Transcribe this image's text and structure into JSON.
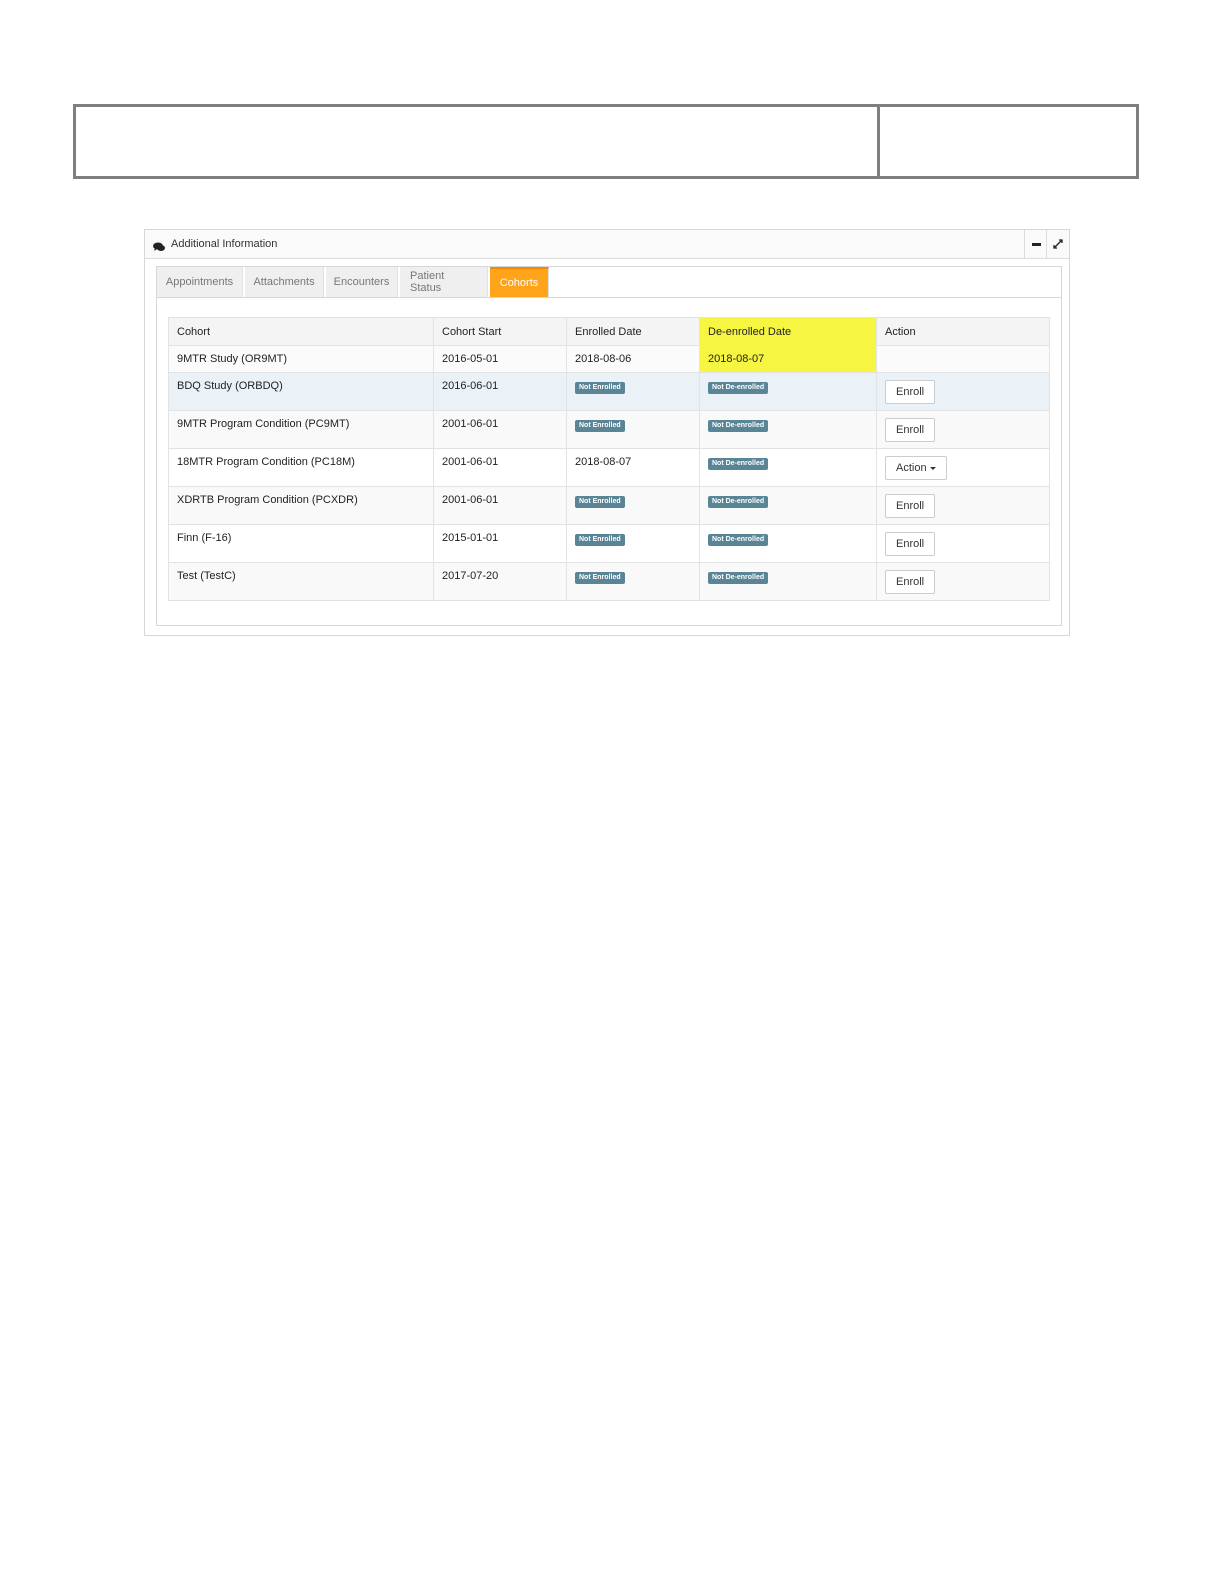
{
  "panel": {
    "title": "Additional Information"
  },
  "tabs": [
    "Appointments",
    "Attachments",
    "Encounters",
    "Patient Status",
    "Cohorts"
  ],
  "table": {
    "headers": [
      "Cohort",
      "Cohort Start",
      "Enrolled Date",
      "De-enrolled Date",
      "Action"
    ],
    "rows": [
      {
        "cohort": "9MTR Study (OR9MT)",
        "start": "2016-05-01",
        "enrolled": "2018-08-06",
        "deenrolled": "2018-08-07",
        "action": ""
      },
      {
        "cohort": "BDQ Study (ORBDQ)",
        "start": "2016-06-01",
        "enrolled": "Not Enrolled",
        "deenrolled": "Not De-enrolled",
        "action": "Enroll"
      },
      {
        "cohort": "9MTR Program Condition (PC9MT)",
        "start": "2001-06-01",
        "enrolled": "Not Enrolled",
        "deenrolled": "Not De-enrolled",
        "action": "Enroll"
      },
      {
        "cohort": "18MTR Program Condition (PC18M)",
        "start": "2001-06-01",
        "enrolled": "2018-08-07",
        "deenrolled": "Not De-enrolled",
        "action": "Action"
      },
      {
        "cohort": "XDRTB Program Condition (PCXDR)",
        "start": "2001-06-01",
        "enrolled": "Not Enrolled",
        "deenrolled": "Not De-enrolled",
        "action": "Enroll"
      },
      {
        "cohort": "Finn (F-16)",
        "start": "2015-01-01",
        "enrolled": "Not Enrolled",
        "deenrolled": "Not De-enrolled",
        "action": "Enroll"
      },
      {
        "cohort": "Test (TestC)",
        "start": "2017-07-20",
        "enrolled": "Not Enrolled",
        "deenrolled": "Not De-enrolled",
        "action": "Enroll"
      }
    ]
  },
  "colors": {
    "active_tab": "#ffa31a",
    "badge": "#5a8596",
    "highlight": "#f5f542"
  },
  "icons": {
    "panel": "chat-icon",
    "minimize": "minus-icon",
    "expand": "expand-icon",
    "dropdown": "caret-down-icon"
  }
}
